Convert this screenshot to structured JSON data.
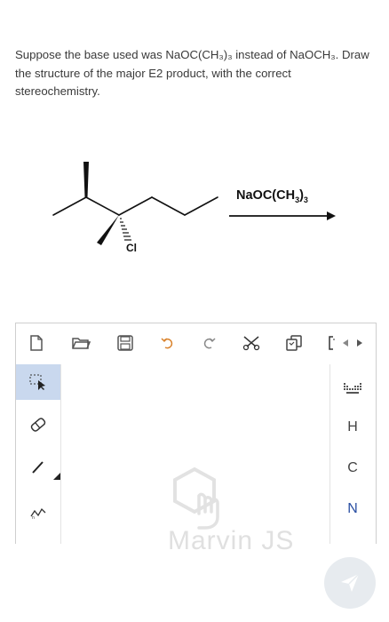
{
  "question": {
    "text": "Suppose the base used was NaOC(CH₃)₃ instead of NaOCH₃. Draw the structure of the major E2 product, with the correct stereochemistry."
  },
  "reaction": {
    "reagent_prefix": "NaOC(CH",
    "reagent_sub1": "3",
    "reagent_mid": ")",
    "reagent_sub2": "3",
    "leaving_group": "Cl"
  },
  "editor": {
    "toolbar_icons": [
      "new-document-icon",
      "open-folder-icon",
      "save-icon",
      "undo-icon",
      "redo-icon",
      "cut-icon",
      "copy-icon",
      "bracket-icon",
      "arrow-left-icon",
      "arrow-right-icon"
    ],
    "left_tools": [
      "select-icon",
      "eraser-icon",
      "single-bond-icon",
      "chain-icon"
    ],
    "right_tools": {
      "periodic_table": "periodic-table-icon",
      "atom_h": "H",
      "atom_c": "C",
      "atom_n": "N"
    },
    "watermark": "Marvin JS"
  },
  "colors": {
    "nitrogen": "#2a4fa3",
    "active_tool": "#c9d8ee",
    "send_button": "#e7ebef"
  }
}
